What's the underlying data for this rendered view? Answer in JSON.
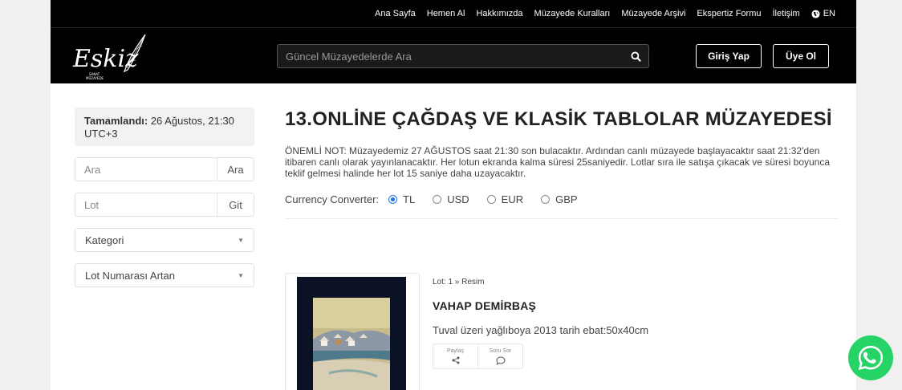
{
  "topnav": {
    "items": [
      "Ana Sayfa",
      "Hemen Al",
      "Hakkımızda",
      "Müzayede Kuralları",
      "Müzayede Arşivi",
      "Ekspertiz Formu",
      "İletişim"
    ],
    "lang": "EN"
  },
  "header": {
    "logo_text": "Eskiz",
    "logo_sub_1": "SANAT",
    "logo_sub_2": "MÜZAYEDE",
    "search_placeholder": "Güncel Müzayedelerde Ara",
    "login_label": "Giriş Yap",
    "signup_label": "Üye Ol"
  },
  "sidebar": {
    "status_label": "Tamamlandı:",
    "status_value": " 26 Ağustos, 21:30 UTC+3",
    "search_placeholder": "Ara",
    "search_btn": "Ara",
    "lot_placeholder": "Lot",
    "lot_btn": "Git",
    "category_select": "Kategori",
    "sort_select": "Lot Numarası Artan"
  },
  "main": {
    "title": "13.ONLİNE ÇAĞDAŞ VE KLASİK TABLOLAR MÜZAYEDESİ",
    "note": "ÖNEMLİ NOT: Müzayedemiz 27 AĞUSTOS saat 21:30 son bulacaktır. Ardından canlı müzayede başlayacaktır saat 21:32'den itibaren canlı olarak yayınlanacaktır. Her lotun ekranda kalma süresi 25saniyedir. Lotlar sıra ile satışa çıkacak ve süresi boyunca teklif gelmesi halinde her lot 15 saniye daha uzayacaktır.",
    "currency_label": "Currency Converter:",
    "currencies": [
      "TL",
      "USD",
      "EUR",
      "GBP"
    ],
    "selected_currency": "TL"
  },
  "lot": {
    "lot_line": "Lot: 1 » Resim",
    "artist": "VAHAP DEMİRBAŞ",
    "description": "Tuval üzeri yağlıboya 2013 tarih ebat:50x40cm",
    "share_label": "Paylaş",
    "ask_label": "Soru Sor"
  },
  "colors": {
    "nav_bg": "#000000",
    "accent_radio": "#1a73e8",
    "whatsapp": "#25d366"
  }
}
